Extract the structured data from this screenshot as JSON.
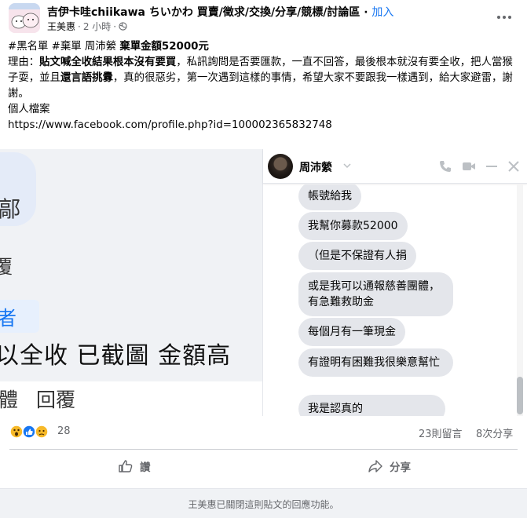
{
  "header": {
    "group_name": "吉伊卡哇chiikawa ちいかわ 買賣/徵求/交換/分享/競標/討論區",
    "join_label": "加入",
    "author": "王美惠",
    "time": "2 小時"
  },
  "post": {
    "line1_tags": "#黑名單 #棄單 周沛縈 ",
    "line1_bold": "棄單金額52000元",
    "reason_prefix": "理由：",
    "reason_bold1": "貼文喊全收結果根本沒有要買",
    "reason_mid1": "，私訊詢問是否要匯款，一直不回答，最後根本就沒有要全收，把人當猴子耍，並且",
    "reason_bold2": "還言語挑釁",
    "reason_end": "，真的很惡劣，第一次遇到這樣的事情，希望大家不要跟我一樣遇到，給大家避雷，謝謝。",
    "profile_label": "個人檔案",
    "profile_url": "https://www.facebook.com/profile.php?id=100002365832748"
  },
  "screenshot": {
    "left_fragments": [
      "鄗",
      "覆",
      "者",
      "以全收 已截圖 金額高",
      "體",
      "回覆"
    ],
    "chat_name": "周沛縈",
    "messages": [
      "帳號給我",
      "我幫你募款52000",
      "（但是不保證有人捐",
      "或是我可以通報慈善團體，有急難救助金",
      "每個月有一筆現金",
      "有證明有困難我很樂意幫忙",
      "我是認真的"
    ]
  },
  "stats": {
    "reaction_icons": [
      "wow-icon",
      "like-icon",
      "sad-icon"
    ],
    "reaction_count": "28",
    "comments": "23則留言",
    "shares": "8次分享"
  },
  "actions": {
    "like_label": "讚",
    "share_label": "分享"
  },
  "footer": {
    "closed_notice": "王美惠已關閉這則貼文的回應功能。"
  },
  "colors": {
    "accent": "#1877f2",
    "secondary_text": "#65676b",
    "bubble": "#e4e6eb"
  }
}
